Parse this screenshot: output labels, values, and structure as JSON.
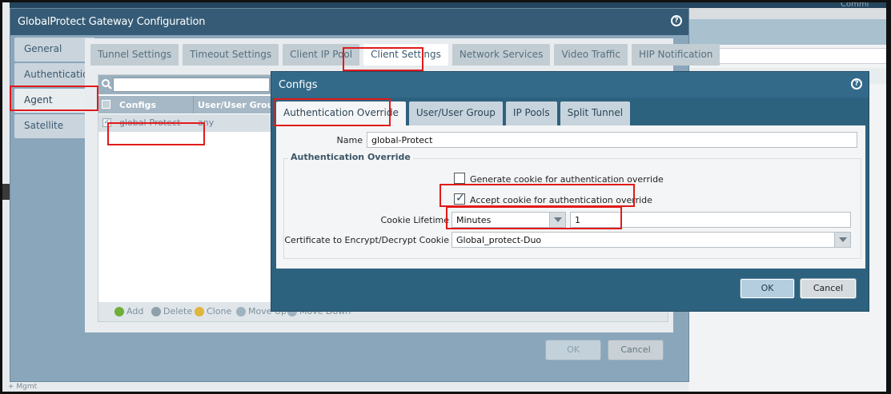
{
  "background": {
    "commit_label": "Commi",
    "bottom_text": "+ Mgmt"
  },
  "gp_dialog": {
    "title": "GlobalProtect Gateway Configuration",
    "side_nav": [
      {
        "label": "General"
      },
      {
        "label": "Authentication"
      },
      {
        "label": "Agent"
      },
      {
        "label": "Satellite"
      }
    ],
    "tabs": [
      {
        "label": "Tunnel Settings"
      },
      {
        "label": "Timeout Settings"
      },
      {
        "label": "Client IP Pool"
      },
      {
        "label": "Client Settings"
      },
      {
        "label": "Network Services"
      },
      {
        "label": "Video Traffic"
      },
      {
        "label": "HIP Notification"
      }
    ],
    "table": {
      "headers": [
        "Configs",
        "User/User Group"
      ],
      "rows": [
        {
          "configs": "global-Protect",
          "user_group": "any",
          "checked": true
        }
      ]
    },
    "actions": {
      "add": "Add",
      "delete": "Delete",
      "clone": "Clone",
      "move_up": "Move Up",
      "move_down": "Move Down"
    },
    "ok_label": "OK",
    "cancel_label": "Cancel"
  },
  "configs_dialog": {
    "title": "Configs",
    "tabs": [
      {
        "label": "Authentication Override"
      },
      {
        "label": "User/User Group"
      },
      {
        "label": "IP Pools"
      },
      {
        "label": "Split Tunnel"
      }
    ],
    "name_label": "Name",
    "name_value": "global-Protect",
    "section_title": "Authentication Override",
    "generate_cookie_label": "Generate cookie for authentication override",
    "generate_cookie_checked": false,
    "accept_cookie_label": "Accept cookie for authentication override",
    "accept_cookie_checked": true,
    "cookie_lifetime_label": "Cookie Lifetime",
    "cookie_lifetime_unit": "Minutes",
    "cookie_lifetime_value": "1",
    "certificate_label": "Certificate to Encrypt/Decrypt Cookie",
    "certificate_value": "Global_protect-Duo",
    "ok_label": "OK",
    "cancel_label": "Cancel"
  },
  "colors": {
    "titlebar": "#355b76",
    "highlight": "#e11a1a"
  }
}
